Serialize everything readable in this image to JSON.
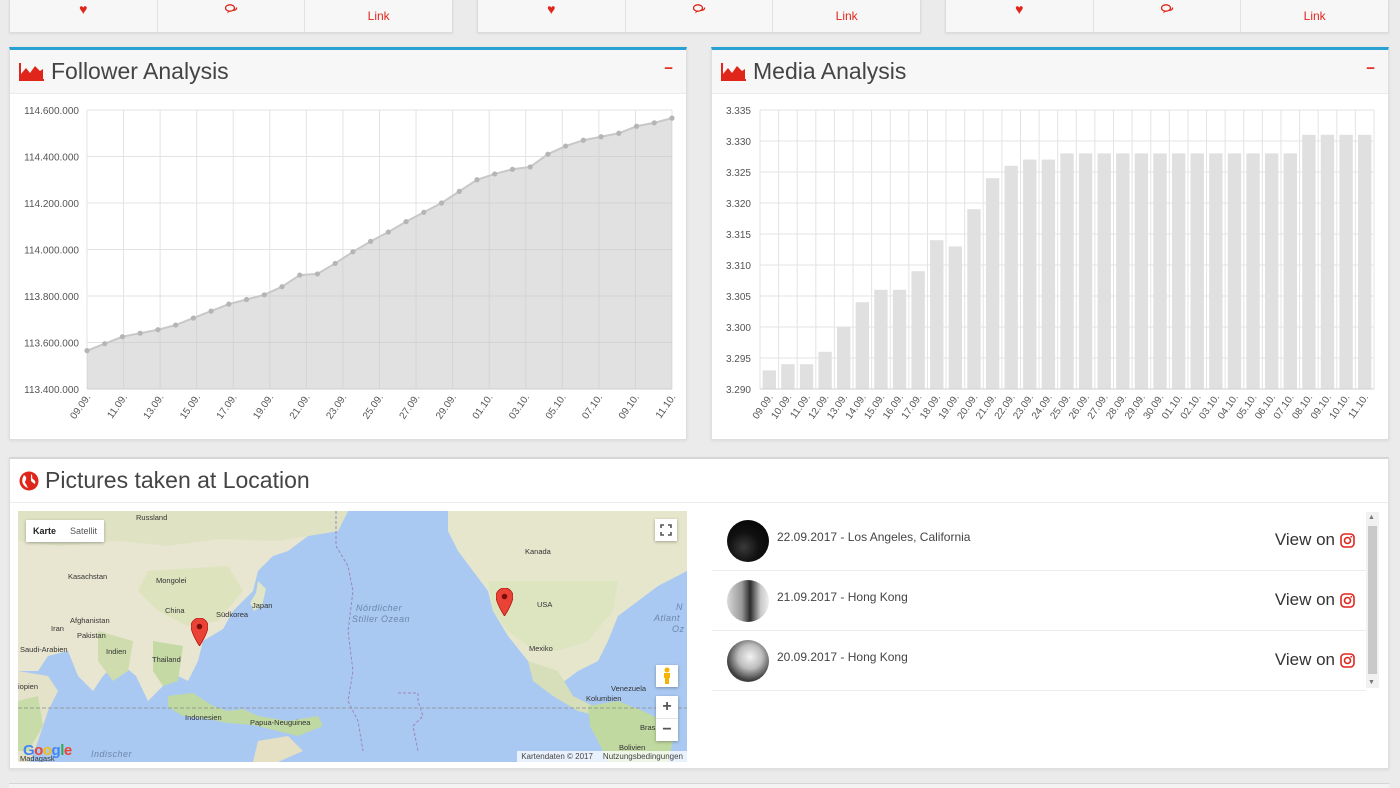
{
  "top_strip": [
    {
      "link_label": "Link"
    },
    {
      "link_label": "Link"
    },
    {
      "link_label": "Link"
    }
  ],
  "follower_panel": {
    "title": "Follower Analysis",
    "collapse_label": "−",
    "icon": "area-chart-icon"
  },
  "media_panel": {
    "title": "Media Analysis",
    "collapse_label": "−",
    "icon": "area-chart-icon"
  },
  "location_panel": {
    "title": "Pictures taken at Location",
    "icon": "globe-icon",
    "map": {
      "type_active": "Karte",
      "type_inactive": "Satellit",
      "footer_data": "Kartendaten © 2017",
      "footer_terms": "Nutzungsbedingungen",
      "logo": "Google",
      "labels": {
        "russland": "Russland",
        "kasachstan": "Kasachstan",
        "mongolei": "Mongolei",
        "china": "China",
        "japan": "Japan",
        "suedkorea": "Südkorea",
        "afghanistan": "Afghanistan",
        "iran": "Iran",
        "pakistan": "Pakistan",
        "saudi": "Saudi-Arabien",
        "indien": "Indien",
        "thailand": "Thailand",
        "indonesien": "Indonesien",
        "papua": "Papua-Neuguinea",
        "kanada": "Kanada",
        "usa": "USA",
        "mexiko": "Mexiko",
        "venezuela": "Venezuela",
        "kolumbien": "Kolumbien",
        "brasilien": "Bras",
        "bolivien": "Bolivien",
        "pacific_1": "Nördlicher",
        "pacific_2": "Stiller Ozean",
        "indian": "Indischer",
        "atlantic_1": "N",
        "atlantic_2": "Atlant",
        "atlantic_3": "Oz",
        "aethiopien": "iopien",
        "madagaskar": "Madagask"
      }
    },
    "pictures": [
      {
        "date": "22.09.2017",
        "location": "Los Angeles, California",
        "caption": "22.09.2017 - Los Angeles, California",
        "view_label": "View on"
      },
      {
        "date": "21.09.2017",
        "location": "Hong Kong",
        "caption": "21.09.2017 - Hong Kong",
        "view_label": "View on"
      },
      {
        "date": "20.09.2017",
        "location": "Hong Kong",
        "caption": "20.09.2017 - Hong Kong",
        "view_label": "View on"
      }
    ]
  },
  "chart_data": [
    {
      "type": "area",
      "title": "",
      "ylim": [
        113400000,
        114600000
      ],
      "y_ticks": [
        "113.400.000",
        "113.600.000",
        "113.800.000",
        "114.000.000",
        "114.200.000",
        "114.400.000",
        "114.600.000"
      ],
      "x_tick_labels": [
        "09.09.",
        "11.09.",
        "13.09.",
        "15.09.",
        "17.09.",
        "19.09.",
        "21.09.",
        "23.09.",
        "25.09.",
        "27.09.",
        "29.09.",
        "01.10.",
        "03.10.",
        "05.10.",
        "07.10.",
        "09.10.",
        "11.10."
      ],
      "grid": true,
      "series": [
        {
          "values": [
            113565000,
            113595000,
            113625000,
            113640000,
            113655000,
            113675000,
            113705000,
            113735000,
            113765000,
            113785000,
            113805000,
            113840000,
            113890000,
            113895000,
            113940000,
            113990000,
            114035000,
            114075000,
            114120000,
            114160000,
            114200000,
            114250000,
            114300000,
            114325000,
            114345000,
            114355000,
            114410000,
            114445000,
            114470000,
            114485000,
            114500000,
            114530000,
            114545000,
            114565000
          ]
        }
      ]
    },
    {
      "type": "bar",
      "title": "",
      "ylim": [
        3.29,
        3.335
      ],
      "y_ticks": [
        "3.290",
        "3.295",
        "3.300",
        "3.305",
        "3.310",
        "3.315",
        "3.320",
        "3.325",
        "3.330",
        "3.335"
      ],
      "categories": [
        "09.09.",
        "10.09.",
        "11.09.",
        "12.09.",
        "13.09.",
        "14.09.",
        "15.09.",
        "16.09.",
        "17.09.",
        "18.09.",
        "19.09.",
        "20.09.",
        "21.09.",
        "22.09.",
        "23.09.",
        "24.09.",
        "25.09.",
        "26.09.",
        "27.09.",
        "28.09.",
        "29.09.",
        "30.09.",
        "01.10.",
        "02.10.",
        "03.10.",
        "04.10.",
        "05.10.",
        "06.10.",
        "07.10.",
        "08.10.",
        "09.10.",
        "10.10.",
        "11.10."
      ],
      "grid": true,
      "series": [
        {
          "values": [
            3.293,
            3.294,
            3.294,
            3.296,
            3.3,
            3.304,
            3.306,
            3.306,
            3.309,
            3.314,
            3.313,
            3.319,
            3.324,
            3.326,
            3.327,
            3.327,
            3.328,
            3.328,
            3.328,
            3.328,
            3.328,
            3.328,
            3.328,
            3.328,
            3.328,
            3.328,
            3.328,
            3.328,
            3.328,
            3.331,
            3.331,
            3.331,
            3.331
          ]
        }
      ]
    }
  ]
}
